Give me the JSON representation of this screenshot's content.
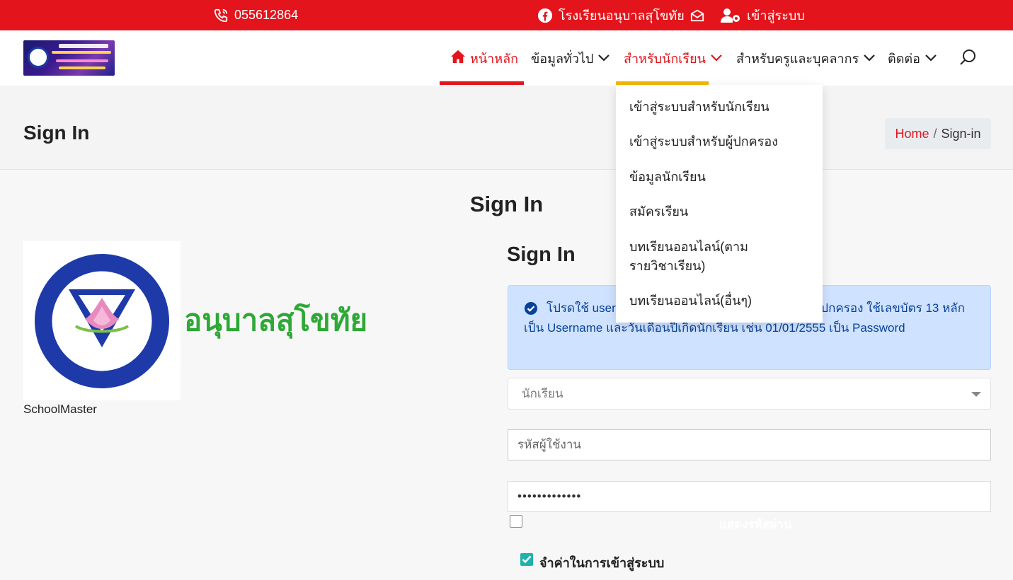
{
  "topbar": {
    "phone": "055612864",
    "facebook_label": "โรงเรียนอนุบาลสุโขทัย",
    "login_label": "เข้าสู่ระบบ"
  },
  "nav": {
    "home": "หน้าหลัก",
    "general": "ข้อมูลทั่วไป",
    "students": "สำหรับนักเรียน",
    "staff": "สำหรับครูและบุคลากร",
    "contact": "ติดต่อ"
  },
  "dropdown": {
    "items": [
      "เข้าสู่ระบบสำหรับนักเรียน",
      "เข้าสู่ระบบสำหรับผู้ปกครอง",
      "ข้อมูลนักเรียน",
      "สมัครเรียน",
      "บทเรียนออนไลน์(ตามรายวิชาเรียน)",
      "บทเรียนออนไลน์(อื่นๆ)"
    ]
  },
  "header": {
    "title": "Sign In",
    "breadcrumb_home": "Home",
    "breadcrumb_sep": "/",
    "breadcrumb_current": "Sign-in"
  },
  "main": {
    "title": "Sign In"
  },
  "school": {
    "name": "อนุบาลสุโขทัย",
    "caption": "SchoolMaster"
  },
  "form": {
    "title": "Sign In",
    "alert": "โปรดใช้ username และรหัสผ่านสำหรับนักเรียนและผู้ปกครอง ใช้เลขบัตร 13 หลัก เป็น Username และวันเดือนปีเกิดนักเรียน เช่น 01/01/2555 เป็น Password",
    "role_selected": "นักเรียน",
    "username_placeholder": "รหัสผู้ใช้งาน",
    "password_value": "•••••••••••••",
    "show_password_label": "แสดงรหัสผ่าน",
    "remember_label": "จำค่าในการเข้าสู่ระบบ"
  },
  "colors": {
    "brand_red": "#e3141b",
    "accent_yellow": "#f5b800",
    "alert_bg": "#cfe2ff",
    "alert_text": "#084298",
    "school_green": "#2ea836",
    "checkbox_teal": "#20b2aa"
  },
  "icons": {
    "phone": "phone-icon",
    "facebook": "facebook-icon",
    "mail": "mail-icon",
    "user_gear": "user-gear-icon",
    "home": "home-icon",
    "chevron": "chevron-down-icon",
    "search": "search-icon",
    "check_circle": "check-circle-icon"
  }
}
